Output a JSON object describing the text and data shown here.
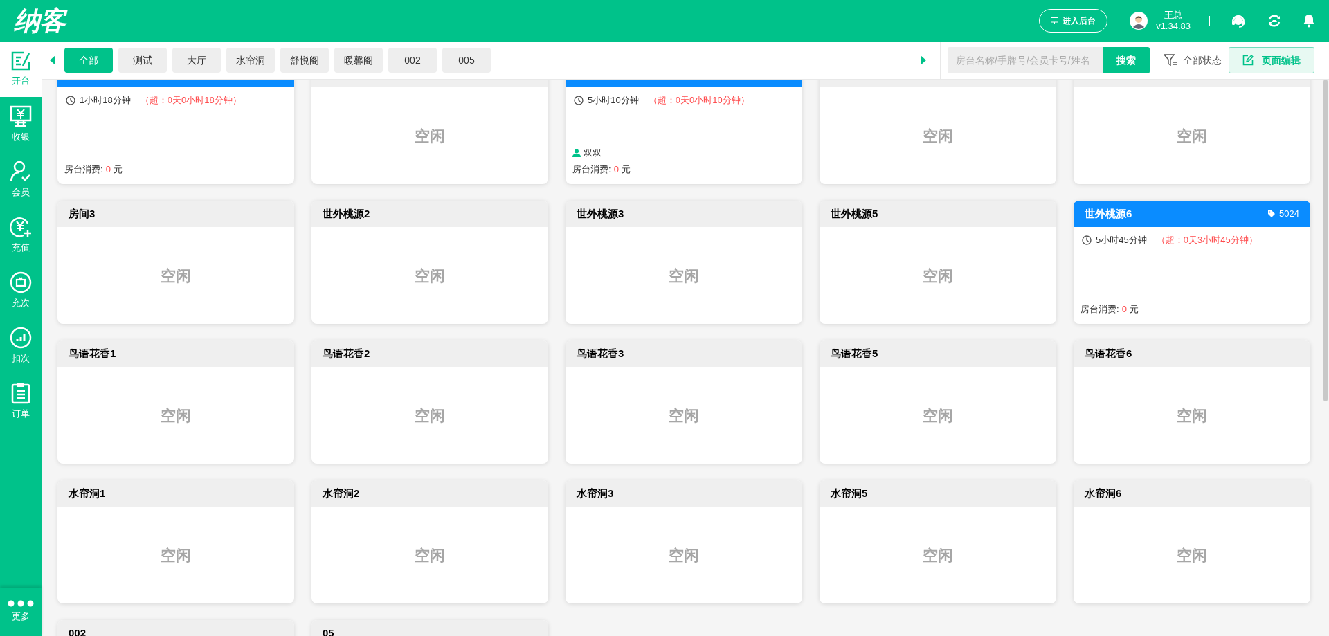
{
  "header": {
    "logo": "纳客",
    "backend_button": "进入后台",
    "user_name": "王总",
    "version": "v1.34.83"
  },
  "sidebar": {
    "items": [
      {
        "label": "开台",
        "selected": true
      },
      {
        "label": "收银",
        "selected": false
      },
      {
        "label": "会员",
        "selected": false
      },
      {
        "label": "充值",
        "selected": false
      },
      {
        "label": "充次",
        "selected": false
      },
      {
        "label": "扣次",
        "selected": false
      },
      {
        "label": "订单",
        "selected": false
      }
    ],
    "more": "更多"
  },
  "tabs": [
    {
      "label": "全部",
      "selected": true
    },
    {
      "label": "测试",
      "selected": false
    },
    {
      "label": "大厅",
      "selected": false
    },
    {
      "label": "水帘洞",
      "selected": false
    },
    {
      "label": "舒悦阁",
      "selected": false
    },
    {
      "label": "暖馨阁",
      "selected": false
    },
    {
      "label": "002",
      "selected": false
    },
    {
      "label": "005",
      "selected": false
    }
  ],
  "search": {
    "placeholder": "房台名称/手牌号/会员卡号/姓名",
    "button": "搜索"
  },
  "filter": "全部状态",
  "edit_button": "页面编辑",
  "rooms": [
    {
      "occupied": true,
      "duration": "1小时18分钟",
      "overtime": "（超：0天0小时18分钟）",
      "consumption_label": "房台消费:",
      "consumption": "0",
      "unit": "元"
    },
    {
      "occupied": false,
      "idle_label": "空闲"
    },
    {
      "occupied": true,
      "duration": "5小时10分钟",
      "overtime": "（超：0天0小时10分钟）",
      "member": "双双",
      "consumption_label": "房台消费:",
      "consumption": "0",
      "unit": "元"
    },
    {
      "occupied": false,
      "idle_label": "空闲"
    },
    {
      "occupied": false,
      "idle_label": "空闲"
    },
    {
      "name": "房间3",
      "occupied": false,
      "idle_label": "空闲"
    },
    {
      "name": "世外桃源2",
      "occupied": false,
      "idle_label": "空闲"
    },
    {
      "name": "世外桃源3",
      "occupied": false,
      "idle_label": "空闲"
    },
    {
      "name": "世外桃源5",
      "occupied": false,
      "idle_label": "空闲"
    },
    {
      "name": "世外桃源6",
      "occupied": true,
      "tag": "5024",
      "duration": "5小时45分钟",
      "overtime": "（超：0天3小时45分钟）",
      "consumption_label": "房台消费:",
      "consumption": "0",
      "unit": "元"
    },
    {
      "name": "鸟语花香1",
      "occupied": false,
      "idle_label": "空闲"
    },
    {
      "name": "鸟语花香2",
      "occupied": false,
      "idle_label": "空闲"
    },
    {
      "name": "鸟语花香3",
      "occupied": false,
      "idle_label": "空闲"
    },
    {
      "name": "鸟语花香5",
      "occupied": false,
      "idle_label": "空闲"
    },
    {
      "name": "鸟语花香6",
      "occupied": false,
      "idle_label": "空闲"
    },
    {
      "name": "水帘洞1",
      "occupied": false,
      "idle_label": "空闲"
    },
    {
      "name": "水帘洞2",
      "occupied": false,
      "idle_label": "空闲"
    },
    {
      "name": "水帘洞3",
      "occupied": false,
      "idle_label": "空闲"
    },
    {
      "name": "水帘洞5",
      "occupied": false,
      "idle_label": "空闲"
    },
    {
      "name": "水帘洞6",
      "occupied": false,
      "idle_label": "空闲"
    },
    {
      "name": "002",
      "occupied": false
    },
    {
      "name": "05",
      "occupied": false
    }
  ]
}
